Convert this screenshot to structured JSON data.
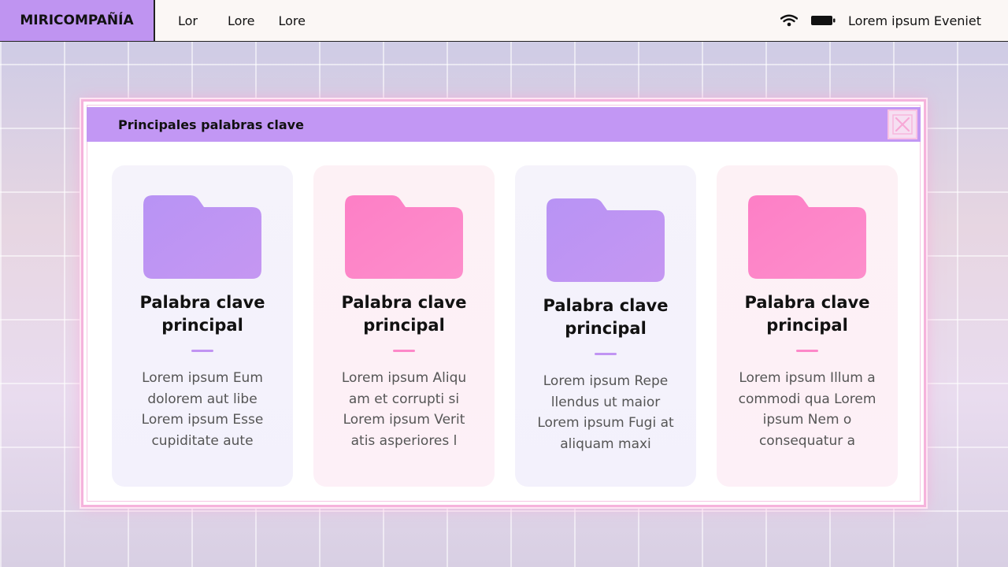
{
  "topbar": {
    "brand": "MIRICOMPAÑÍA",
    "menu": [
      "Lor",
      "Lore",
      "Lore"
    ],
    "status_text": "Lorem ipsum Eveniet",
    "icons": [
      "wifi-icon",
      "battery-icon"
    ]
  },
  "window": {
    "title": "Principales palabras clave",
    "close_icon": "close-icon",
    "cards": [
      {
        "title": "Palabra clave principal",
        "desc": "Lorem ipsum Eum dolorem aut libe Lorem ipsum Esse cupiditate aute",
        "color": "#c194f3"
      },
      {
        "title": "Palabra clave principal",
        "desc": "Lorem ipsum Aliqu am et corrupti si Lorem ipsum Verit atis asperiores l",
        "color": "#fd88c9"
      },
      {
        "title": "Palabra clave principal",
        "desc": "Lorem ipsum Repe llendus ut maior Lorem ipsum Fugi at aliquam maxi",
        "color": "#c194f3"
      },
      {
        "title": "Palabra clave principal",
        "desc": "Lorem ipsum Illum a commodi qua Lorem ipsum Nem o consequatur a",
        "color": "#fd88c9"
      }
    ]
  },
  "colors": {
    "accent_purple": "#c194f3",
    "accent_pink": "#fd88c9",
    "topbar_bg": "#fbf7f5"
  }
}
